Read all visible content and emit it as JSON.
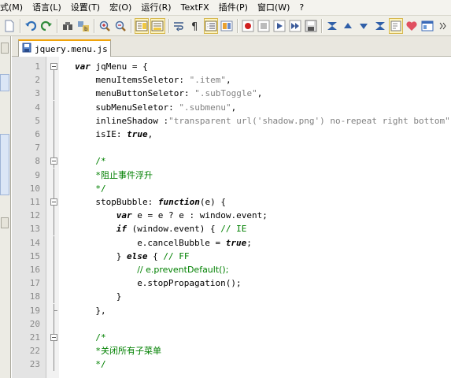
{
  "menu": [
    "式(M)",
    "语言(L)",
    "设置(T)",
    "宏(O)",
    "运行(R)",
    "TextFX",
    "插件(P)",
    "窗口(W)",
    "?"
  ],
  "tab": {
    "label": "jquery.menu.js"
  },
  "code_lines": [
    {
      "n": "1",
      "parts": [
        [
          "kw",
          "var"
        ],
        [
          "p",
          " jqMenu = {"
        ]
      ]
    },
    {
      "n": "2",
      "parts": [
        [
          "p",
          "menuItemsSeletor: "
        ],
        [
          "str",
          "\".item\""
        ],
        [
          "p",
          ","
        ]
      ]
    },
    {
      "n": "3",
      "parts": [
        [
          "p",
          "menuButtonSeletor: "
        ],
        [
          "str",
          "\".subToggle\""
        ],
        [
          "p",
          ","
        ]
      ]
    },
    {
      "n": "4",
      "parts": [
        [
          "p",
          "subMenuSeletor: "
        ],
        [
          "str",
          "\".submenu\""
        ],
        [
          "p",
          ","
        ]
      ]
    },
    {
      "n": "5",
      "parts": [
        [
          "p",
          "inlineShadow :"
        ],
        [
          "str",
          "\"transparent url('shadow.png') no-repeat right bottom\""
        ],
        [
          "p",
          ","
        ]
      ]
    },
    {
      "n": "6",
      "parts": [
        [
          "p",
          "isIE: "
        ],
        [
          "kw",
          "true"
        ],
        [
          "p",
          ","
        ]
      ]
    },
    {
      "n": "7",
      "parts": []
    },
    {
      "n": "8",
      "parts": [
        [
          "cm",
          "/*"
        ]
      ]
    },
    {
      "n": "9",
      "parts": [
        [
          "cm",
          "*"
        ],
        [
          "cmt",
          "阻止事件浮升"
        ]
      ]
    },
    {
      "n": "10",
      "parts": [
        [
          "cm",
          "*/"
        ]
      ]
    },
    {
      "n": "11",
      "parts": [
        [
          "p",
          "stopBubble: "
        ],
        [
          "kw",
          "function"
        ],
        [
          "p",
          "(e) {"
        ]
      ]
    },
    {
      "n": "12",
      "parts": [
        [
          "kw",
          "var"
        ],
        [
          "p",
          " e = e ? e : window.event;"
        ]
      ]
    },
    {
      "n": "13",
      "parts": [
        [
          "kw",
          "if"
        ],
        [
          "p",
          " (window.event) { "
        ],
        [
          "cm",
          "// IE"
        ]
      ]
    },
    {
      "n": "14",
      "parts": [
        [
          "p",
          "e.cancelBubble = "
        ],
        [
          "kw",
          "true"
        ],
        [
          "p",
          ";"
        ]
      ]
    },
    {
      "n": "15",
      "parts": [
        [
          "p",
          "} "
        ],
        [
          "kw",
          "else"
        ],
        [
          "p",
          " { "
        ],
        [
          "cm",
          "// FF"
        ]
      ]
    },
    {
      "n": "16",
      "parts": [
        [
          "cmt",
          "// e.preventDefault();"
        ]
      ]
    },
    {
      "n": "17",
      "parts": [
        [
          "p",
          "e.stopPropagation();"
        ]
      ]
    },
    {
      "n": "18",
      "parts": [
        [
          "p",
          "}"
        ]
      ]
    },
    {
      "n": "19",
      "parts": [
        [
          "p",
          "},"
        ]
      ]
    },
    {
      "n": "20",
      "parts": []
    },
    {
      "n": "21",
      "parts": [
        [
          "cm",
          "/*"
        ]
      ]
    },
    {
      "n": "22",
      "parts": [
        [
          "cm",
          "*"
        ],
        [
          "cmt",
          "关闭所有子菜单"
        ]
      ]
    },
    {
      "n": "23",
      "parts": [
        [
          "cm",
          "*/"
        ]
      ]
    }
  ]
}
